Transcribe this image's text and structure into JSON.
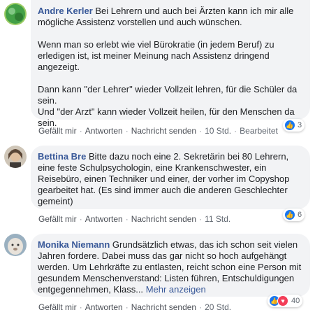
{
  "comments": [
    {
      "author": "Andre Kerler",
      "avatar_color": "#4caf50",
      "paragraphs": [
        "Bei Lehrern und auch bei Ärzten kann ich mir alle mögliche Assistenz vorstellen und auch wünschen.",
        "Wenn man so erlebt wie viel Bürokratie (in jedem Beruf) zu erledigen ist, ist meiner Meinung nach Assistenz dringend angezeigt.",
        "Dann kann \"der Lehrer\" wieder Vollzeit lehren, für die Schüler da sein.\nUnd \"der Arzt\" kann wieder Vollzeit heilen, für den Menschen da sein."
      ],
      "like": "Gefällt mir",
      "reply": "Antworten",
      "message": "Nachricht senden",
      "time": "10 Std.",
      "edited": "Bearbeitet",
      "reaction_count": "3",
      "reaction_icons": [
        "like-icon"
      ]
    },
    {
      "author": "Bettina Bre",
      "avatar_color": "#6b5a4a",
      "paragraphs": [
        "Bitte dazu noch eine 2. Sekretärin bei 80 Lehrern, eine feste Schulpsychologin, eine Krankenschwester, ein Reisebüro, einen Techniker und einer, der vorher im Copyshop gearbeitet hat. (Es sind immer auch die anderen Geschlechter gemeint)"
      ],
      "like": "Gefällt mir",
      "reply": "Antworten",
      "message": "Nachricht senden",
      "time": "11 Std.",
      "reaction_count": "6",
      "reaction_icons": [
        "like-icon"
      ]
    },
    {
      "author": "Monika Niemann",
      "avatar_color": "#b8b0a8",
      "paragraphs": [
        "Grundsätzlich etwas, das ich schon seit vielen Jahren fordere. Dabei muss das gar nicht so hoch aufgehängt werden. Um Lehrkräfte zu entlasten, reicht schon eine Person mit gesundem Menschenverstand: Listen führen, Entschuldigungen entgegennehmen, Klass..."
      ],
      "more": "Mehr anzeigen",
      "like": "Gefällt mir",
      "reply": "Antworten",
      "message": "Nachricht senden",
      "time": "20 Std.",
      "reaction_count": "40",
      "reaction_icons": [
        "like-icon",
        "love-icon"
      ]
    }
  ],
  "colors": {
    "like": "#1877f2",
    "love": "#f33e58",
    "link": "#385898",
    "bubble": "#f2f3f5"
  }
}
